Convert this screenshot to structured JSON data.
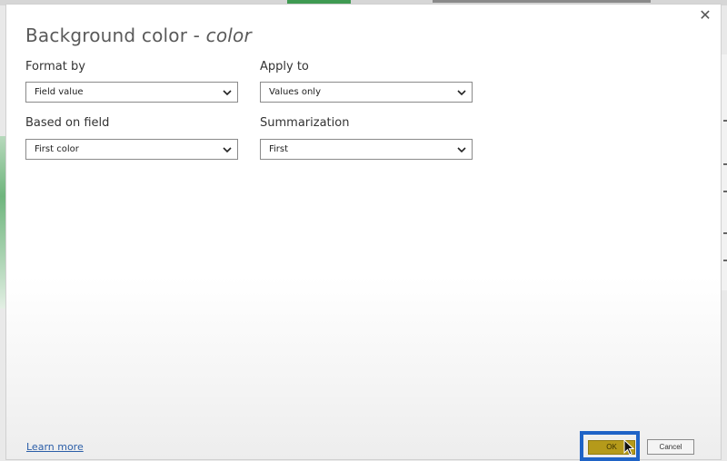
{
  "dialog": {
    "title_main": "Background color - ",
    "title_italic": "color",
    "close_icon": "close-icon"
  },
  "format_by": {
    "label": "Format by",
    "value": "Field value"
  },
  "apply_to": {
    "label": "Apply to",
    "value": "Values only"
  },
  "based_on_field": {
    "label": "Based on field",
    "value": "First color"
  },
  "summarization": {
    "label": "Summarization",
    "value": "First"
  },
  "footer": {
    "learn_more": "Learn more",
    "ok_label": "OK",
    "cancel_label": "Cancel"
  },
  "colors": {
    "ok_button": "#b59a1a",
    "highlight_border": "#1f63c6",
    "link": "#2b5ea8"
  }
}
